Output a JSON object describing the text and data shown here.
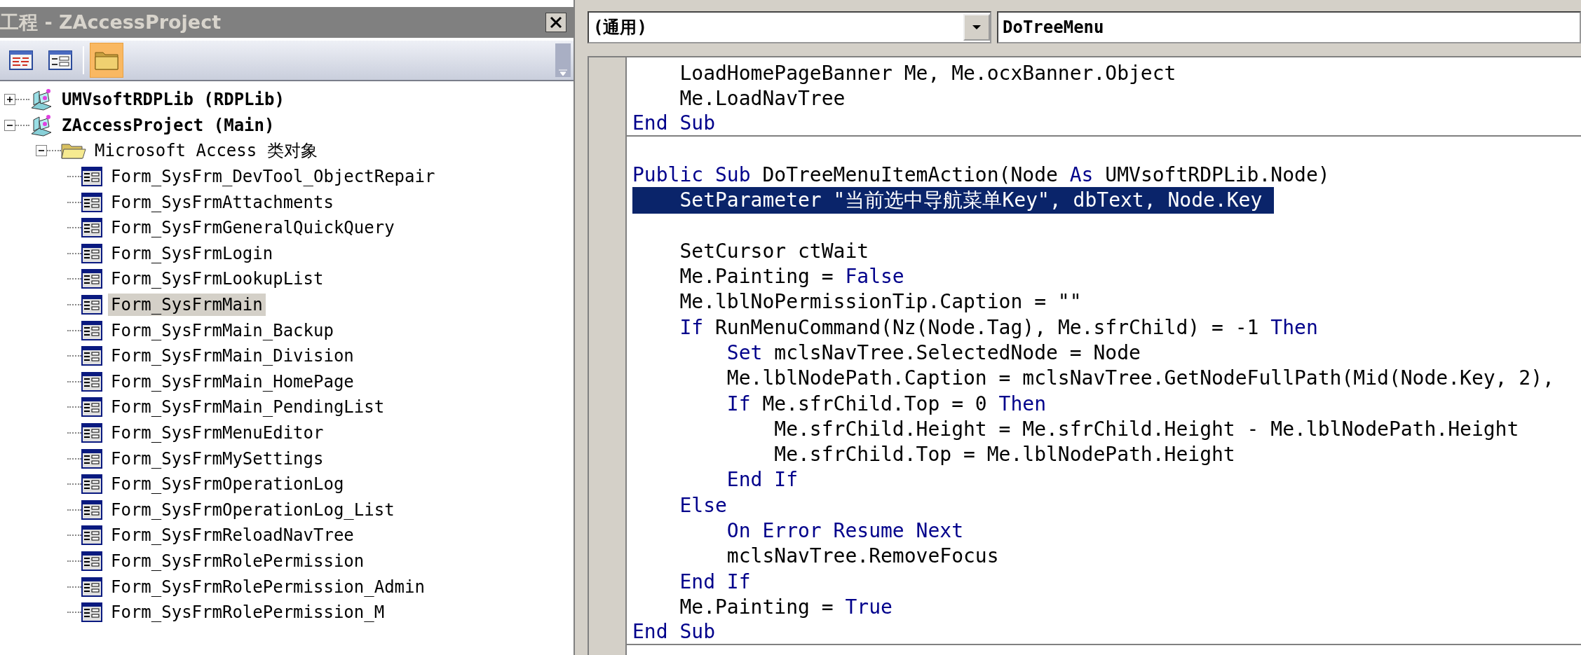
{
  "project_panel": {
    "title": "工程 - ZAccessProject",
    "toolbar": [
      {
        "kind": "view_code",
        "selected": false
      },
      {
        "kind": "view_object",
        "selected": false
      },
      {
        "kind": "toggle_folders",
        "selected": true
      }
    ],
    "tree": [
      {
        "kind": "project",
        "label": "UMVsoftRDPLib (RDPLib)",
        "expanded": false,
        "selected": false
      },
      {
        "kind": "project",
        "label": "ZAccessProject (Main)",
        "expanded": true,
        "selected": false,
        "children": [
          {
            "kind": "folder",
            "label": "Microsoft Access 类对象",
            "expanded": true,
            "selected": false,
            "children": [
              {
                "kind": "form",
                "label": "Form_SysFrm_DevTool_ObjectRepair",
                "selected": false
              },
              {
                "kind": "form",
                "label": "Form_SysFrmAttachments",
                "selected": false
              },
              {
                "kind": "form",
                "label": "Form_SysFrmGeneralQuickQuery",
                "selected": false
              },
              {
                "kind": "form",
                "label": "Form_SysFrmLogin",
                "selected": false
              },
              {
                "kind": "form",
                "label": "Form_SysFrmLookupList",
                "selected": false
              },
              {
                "kind": "form",
                "label": "Form_SysFrmMain",
                "selected": true
              },
              {
                "kind": "form",
                "label": "Form_SysFrmMain_Backup",
                "selected": false
              },
              {
                "kind": "form",
                "label": "Form_SysFrmMain_Division",
                "selected": false
              },
              {
                "kind": "form",
                "label": "Form_SysFrmMain_HomePage",
                "selected": false
              },
              {
                "kind": "form",
                "label": "Form_SysFrmMain_PendingList",
                "selected": false
              },
              {
                "kind": "form",
                "label": "Form_SysFrmMenuEditor",
                "selected": false
              },
              {
                "kind": "form",
                "label": "Form_SysFrmMySettings",
                "selected": false
              },
              {
                "kind": "form",
                "label": "Form_SysFrmOperationLog",
                "selected": false
              },
              {
                "kind": "form",
                "label": "Form_SysFrmOperationLog_List",
                "selected": false
              },
              {
                "kind": "form",
                "label": "Form_SysFrmReloadNavTree",
                "selected": false
              },
              {
                "kind": "form",
                "label": "Form_SysFrmRolePermission",
                "selected": false
              },
              {
                "kind": "form",
                "label": "Form_SysFrmRolePermission_Admin",
                "selected": false
              },
              {
                "kind": "form",
                "label": "Form_SysFrmRolePermission_M",
                "selected": false
              }
            ]
          }
        ]
      }
    ]
  },
  "code_window": {
    "object_dropdown": "(通用)",
    "procedure_dropdown": "DoTreeMenu",
    "lines": [
      {
        "selected": false,
        "divider": false,
        "tokens": [
          {
            "kind": "plain",
            "text": "    LoadHomePageBanner Me, Me.ocxBanner.Object"
          }
        ]
      },
      {
        "selected": false,
        "divider": false,
        "tokens": [
          {
            "kind": "plain",
            "text": "    Me.LoadNavTree"
          }
        ]
      },
      {
        "selected": false,
        "divider": true,
        "tokens": [
          {
            "kind": "keyword",
            "text": "End Sub"
          }
        ]
      },
      {
        "divider": false
      },
      {
        "selected": false,
        "divider": false,
        "tokens": [
          {
            "kind": "keyword",
            "text": "Public Sub"
          },
          {
            "kind": "plain",
            "text": " DoTreeMenuItemAction(Node "
          },
          {
            "kind": "keyword",
            "text": "As"
          },
          {
            "kind": "plain",
            "text": " UMVsoftRDPLib.Node)"
          }
        ]
      },
      {
        "selected": true,
        "divider": false,
        "tokens": [
          {
            "kind": "plain",
            "text": "    SetParameter \"当前选中导航菜单Key\", dbText, Node.Key "
          }
        ]
      },
      {
        "divider": false
      },
      {
        "selected": false,
        "divider": false,
        "tokens": [
          {
            "kind": "plain",
            "text": "    SetCursor ctWait"
          }
        ]
      },
      {
        "selected": false,
        "divider": false,
        "tokens": [
          {
            "kind": "plain",
            "text": "    Me.Painting = "
          },
          {
            "kind": "keyword",
            "text": "False"
          }
        ]
      },
      {
        "selected": false,
        "divider": false,
        "tokens": [
          {
            "kind": "plain",
            "text": "    Me.lblNoPermissionTip.Caption = \"\""
          }
        ]
      },
      {
        "selected": false,
        "divider": false,
        "tokens": [
          {
            "kind": "keyword",
            "text": "    If"
          },
          {
            "kind": "plain",
            "text": " RunMenuCommand(Nz(Node.Tag), Me.sfrChild) = -1 "
          },
          {
            "kind": "keyword",
            "text": "Then"
          }
        ]
      },
      {
        "selected": false,
        "divider": false,
        "tokens": [
          {
            "kind": "keyword",
            "text": "        Set"
          },
          {
            "kind": "plain",
            "text": " mclsNavTree.SelectedNode = Node"
          }
        ]
      },
      {
        "selected": false,
        "divider": false,
        "tokens": [
          {
            "kind": "plain",
            "text": "        Me.lblNodePath.Caption = mclsNavTree.GetNodeFullPath(Mid(Node.Key, 2),"
          }
        ]
      },
      {
        "selected": false,
        "divider": false,
        "tokens": [
          {
            "kind": "keyword",
            "text": "        If"
          },
          {
            "kind": "plain",
            "text": " Me.sfrChild.Top = 0 "
          },
          {
            "kind": "keyword",
            "text": "Then"
          }
        ]
      },
      {
        "selected": false,
        "divider": false,
        "tokens": [
          {
            "kind": "plain",
            "text": "            Me.sfrChild.Height = Me.sfrChild.Height - Me.lblNodePath.Height"
          }
        ]
      },
      {
        "selected": false,
        "divider": false,
        "tokens": [
          {
            "kind": "plain",
            "text": "            Me.sfrChild.Top = Me.lblNodePath.Height"
          }
        ]
      },
      {
        "selected": false,
        "divider": false,
        "tokens": [
          {
            "kind": "keyword",
            "text": "        End If"
          }
        ]
      },
      {
        "selected": false,
        "divider": false,
        "tokens": [
          {
            "kind": "keyword",
            "text": "    Else"
          }
        ]
      },
      {
        "selected": false,
        "divider": false,
        "tokens": [
          {
            "kind": "keyword",
            "text": "        On Error Resume Next"
          }
        ]
      },
      {
        "selected": false,
        "divider": false,
        "tokens": [
          {
            "kind": "plain",
            "text": "        mclsNavTree.RemoveFocus"
          }
        ]
      },
      {
        "selected": false,
        "divider": false,
        "tokens": [
          {
            "kind": "keyword",
            "text": "    End If"
          }
        ]
      },
      {
        "selected": false,
        "divider": false,
        "tokens": [
          {
            "kind": "plain",
            "text": "    Me.Painting = "
          },
          {
            "kind": "keyword",
            "text": "True"
          }
        ]
      },
      {
        "selected": false,
        "divider": true,
        "tokens": [
          {
            "kind": "keyword",
            "text": "End Sub"
          }
        ]
      }
    ]
  }
}
